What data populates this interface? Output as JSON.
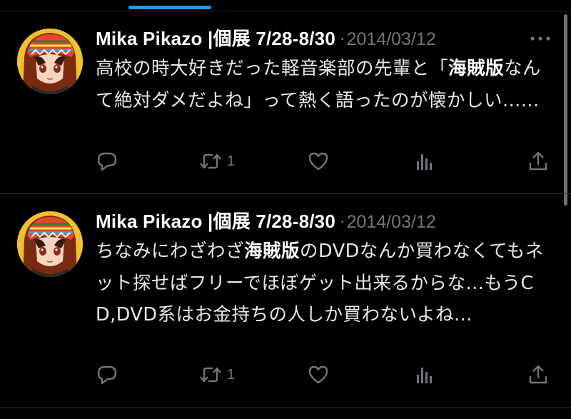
{
  "colors": {
    "background": "#000000",
    "accent": "#1d9bf0",
    "text": "#e7e9ea",
    "secondary": "#71767b",
    "divider": "#2f3336"
  },
  "tweets": [
    {
      "author": "Mika Pikazo |個展 7/28-8/30",
      "separator": "·",
      "date": "2014/03/12",
      "text_parts": [
        "高校の時大好きだった軽音楽部の先輩と",
        "「",
        "海賊版",
        "なんて絶対ダメだよね」って熱く語ったのが懐かしい......"
      ],
      "text_bold": [
        false,
        false,
        true,
        false
      ],
      "icons": {
        "reply": "reply-icon",
        "retweet": "retweet-icon",
        "like": "heart-icon",
        "views": "views-icon",
        "share": "share-icon",
        "more": "more-icon"
      },
      "retweet_count": "1"
    },
    {
      "author": "Mika Pikazo |個展 7/28-8/30",
      "separator": "·",
      "date": "2014/03/12",
      "text_parts": [
        "ちなみにわざわざ",
        "海賊版",
        "のDVDなんか買わなくてもネット探せばフリーでほぼゲット出来るからな...もうCD,DVD系はお金持ちの人しか買わないよね..."
      ],
      "text_bold": [
        false,
        true,
        false
      ],
      "icons": {
        "reply": "reply-icon",
        "retweet": "retweet-icon",
        "like": "heart-icon",
        "views": "views-icon",
        "share": "share-icon",
        "more": "more-icon"
      },
      "retweet_count": "1"
    }
  ]
}
